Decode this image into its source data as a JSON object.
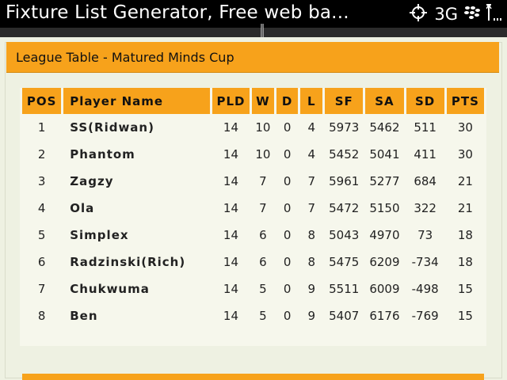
{
  "status_bar": {
    "title": "Fixture List Generator, Free web ba...",
    "network": "3G",
    "icons": [
      "location-crosshair-icon",
      "blackberry-logo-icon",
      "signal-antenna-icon"
    ]
  },
  "panel": {
    "title": "League Table - Matured Minds Cup"
  },
  "table": {
    "headers": [
      "POS",
      "Player Name",
      "PLD",
      "W",
      "D",
      "L",
      "SF",
      "SA",
      "SD",
      "PTS"
    ],
    "rows": [
      [
        "1",
        "SS(Ridwan)",
        "14",
        "10",
        "0",
        "4",
        "5973",
        "5462",
        "511",
        "30"
      ],
      [
        "2",
        "Phantom",
        "14",
        "10",
        "0",
        "4",
        "5452",
        "5041",
        "411",
        "30"
      ],
      [
        "3",
        "Zagzy",
        "14",
        "7",
        "0",
        "7",
        "5961",
        "5277",
        "684",
        "21"
      ],
      [
        "4",
        "Ola",
        "14",
        "7",
        "0",
        "7",
        "5472",
        "5150",
        "322",
        "21"
      ],
      [
        "5",
        "Simplex",
        "14",
        "6",
        "0",
        "8",
        "5043",
        "4970",
        "73",
        "18"
      ],
      [
        "6",
        "Radzinski(Rich)",
        "14",
        "6",
        "0",
        "8",
        "5475",
        "6209",
        "-734",
        "18"
      ],
      [
        "7",
        "Chukwuma",
        "14",
        "5",
        "0",
        "9",
        "5511",
        "6009",
        "-498",
        "15"
      ],
      [
        "8",
        "Ben",
        "14",
        "5",
        "0",
        "9",
        "5407",
        "6176",
        "-769",
        "15"
      ]
    ]
  },
  "colors": {
    "accent": "#f7a21b",
    "background": "#eef1e2",
    "status_bar": "#000000"
  }
}
